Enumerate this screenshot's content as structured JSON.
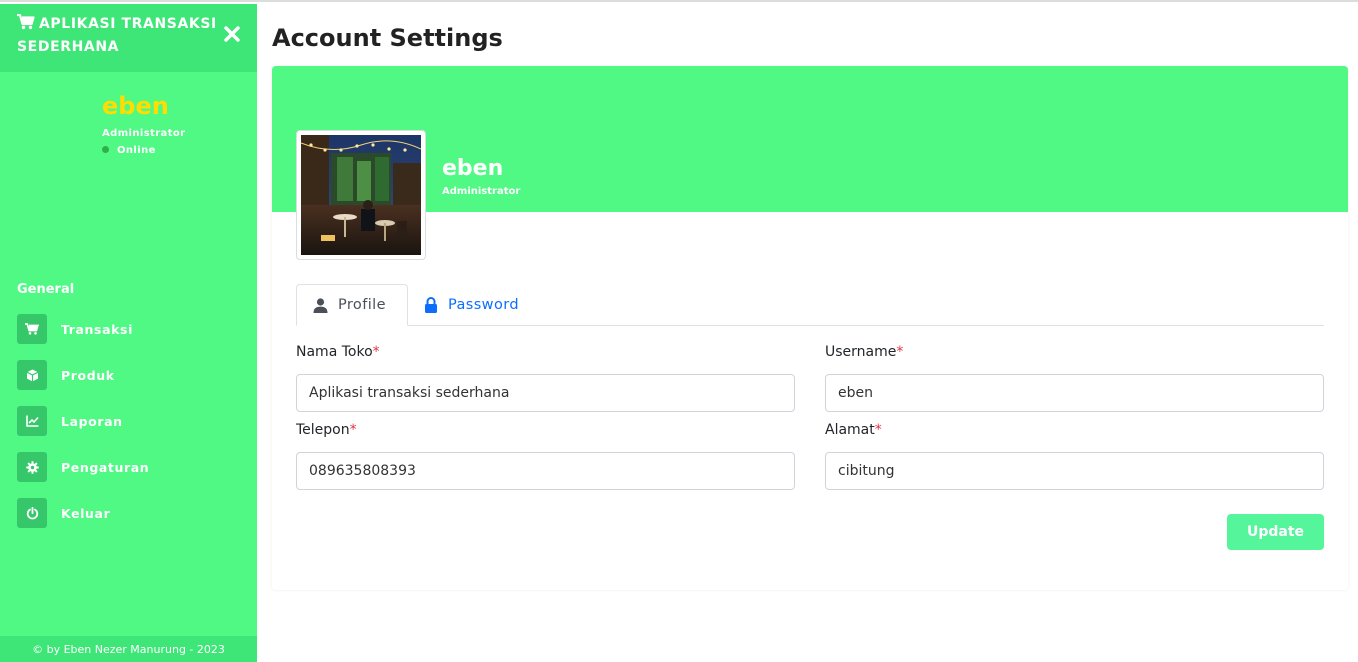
{
  "brand": {
    "title": "APLIKASI TRANSAKSI SEDERHANA"
  },
  "user": {
    "name": "eben",
    "role": "Administrator",
    "status": "Online"
  },
  "nav": {
    "heading": "General",
    "items": [
      {
        "label": "Transaksi",
        "icon": "cart-icon"
      },
      {
        "label": "Produk",
        "icon": "box-icon"
      },
      {
        "label": "Laporan",
        "icon": "chart-icon"
      },
      {
        "label": "Pengaturan",
        "icon": "gear-icon"
      },
      {
        "label": "Keluar",
        "icon": "power-icon"
      }
    ]
  },
  "footer": {
    "text": "© by Eben Nezer Manurung - 2023"
  },
  "page": {
    "title": "Account Settings"
  },
  "profile": {
    "name": "eben",
    "role": "Administrator"
  },
  "tabs": {
    "profile": "Profile",
    "password": "Password"
  },
  "form": {
    "nama_toko": {
      "label": "Nama Toko",
      "value": "Aplikasi transaksi sederhana"
    },
    "username": {
      "label": "Username",
      "value": "eben"
    },
    "telepon": {
      "label": "Telepon",
      "value": "089635808393"
    },
    "alamat": {
      "label": "Alamat",
      "value": "cibitung"
    },
    "required_mark": "*",
    "submit_label": "Update"
  },
  "colors": {
    "sidebar": "#4ff984",
    "brand_bar": "#3ee577",
    "username_accent": "#ffdd00",
    "update_button": "#55f59c",
    "tab_link": "#0d6efd",
    "required": "#dc3545"
  }
}
